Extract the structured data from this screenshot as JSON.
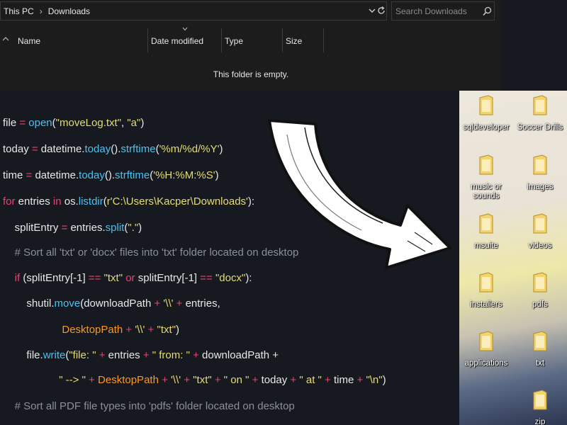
{
  "explorer": {
    "breadcrumb": [
      "This PC",
      "Downloads"
    ],
    "search_placeholder": "Search Downloads",
    "columns": [
      "Name",
      "Date modified",
      "Type",
      "Size"
    ],
    "empty_message": "This folder is empty."
  },
  "code": {
    "lines": [
      "file = open(\"moveLog.txt\", \"a\")",
      "today = datetime.today().strftime('%m/%d/%Y')",
      "time = datetime.today().strftime('%H:%M:%S')",
      "for entries in os.listdir(r'C:\\Users\\Kacper\\Downloads'):",
      "    splitEntry = entries.split(\".\")",
      "    # Sort all 'txt' or 'docx' files into 'txt' folder located on desktop",
      "    if (splitEntry[-1] == \"txt\" or splitEntry[-1] == \"docx\"):",
      "        shutil.move(downloadPath + '\\\\' + entries,",
      "                    DesktopPath + '\\\\' + \"txt\")",
      "        file.write(\"file: \" + entries + \" from: \" + downloadPath +",
      "                   \" --> \" + DesktopPath + '\\\\' + \"txt\" + \" on \" + today + \" at \" + time + \"\\n\")",
      "    # Sort all PDF file types into 'pdfs' folder located on desktop"
    ]
  },
  "desktop": {
    "icons": [
      {
        "label": "sqldeveloper",
        "icon": "folder-icon"
      },
      {
        "label": "Soccer Drills",
        "icon": "folder-icon"
      },
      {
        "label": "music or sounds",
        "icon": "folder-icon"
      },
      {
        "label": "images",
        "icon": "folder-icon"
      },
      {
        "label": "msuite",
        "icon": "folder-icon"
      },
      {
        "label": "videos",
        "icon": "folder-icon"
      },
      {
        "label": "installers",
        "icon": "folder-icon"
      },
      {
        "label": "pdfs",
        "icon": "folder-icon"
      },
      {
        "label": "applications",
        "icon": "folder-icon"
      },
      {
        "label": "txt",
        "icon": "folder-icon"
      },
      {
        "label": "zip",
        "icon": "folder-icon"
      }
    ]
  },
  "colors": {
    "keyword": "#e6436e",
    "function": "#4dc0f0",
    "string": "#e6db74",
    "variable": "#fd971f",
    "comment": "#8a8f98",
    "folder": "#f3d36b"
  }
}
